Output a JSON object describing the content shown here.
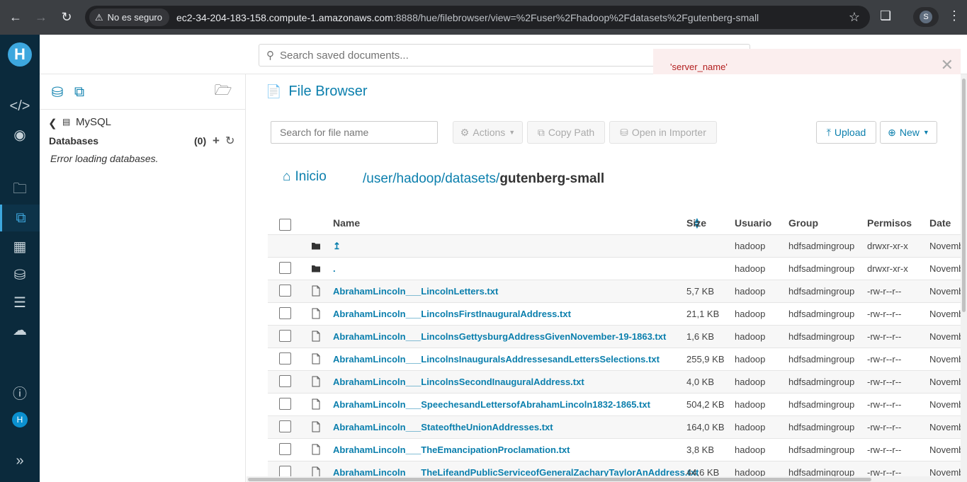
{
  "browser": {
    "security_label": "No es seguro",
    "url_host": "ec2-34-204-183-158.compute-1.amazonaws.com",
    "url_path": ":8888/hue/filebrowser/view=%2Fuser%2Fhadoop%2Fdatasets%2Fgutenberg-small",
    "profile_initial": "S"
  },
  "header": {
    "search_placeholder": "Search saved documents..."
  },
  "alert": {
    "message": "'server_name'"
  },
  "nav": {
    "logo_letter": "H",
    "avatar_letter": "H"
  },
  "assist": {
    "source": "MySQL",
    "databases_title": "Databases",
    "databases_count": "(0)",
    "error": "Error loading databases."
  },
  "main": {
    "title": "File Browser",
    "file_search_placeholder": "Search for file name",
    "actions_label": "Actions",
    "copy_path_label": "Copy Path",
    "open_importer_label": "Open in Importer",
    "upload_label": "Upload",
    "new_label": "New",
    "home_label": "Inicio",
    "path_prefix": "/user/hadoop/datasets/",
    "path_current": "gutenberg-small"
  },
  "table": {
    "headers": {
      "name": "Name",
      "size": "Size",
      "user": "Usuario",
      "group": "Group",
      "perms": "Permisos",
      "date": "Date"
    },
    "rows": [
      {
        "type": "folder",
        "name": "↥",
        "size": "",
        "user": "hadoop",
        "group": "hdfsadmingroup",
        "perms": "drwxr-xr-x",
        "date": "Novemb"
      },
      {
        "type": "folder",
        "name": ".",
        "size": "",
        "user": "hadoop",
        "group": "hdfsadmingroup",
        "perms": "drwxr-xr-x",
        "date": "Novemb"
      },
      {
        "type": "file",
        "name": "AbrahamLincoln___LincolnLetters.txt",
        "size": "5,7 KB",
        "user": "hadoop",
        "group": "hdfsadmingroup",
        "perms": "-rw-r--r--",
        "date": "Novemb"
      },
      {
        "type": "file",
        "name": "AbrahamLincoln___LincolnsFirstInauguralAddress.txt",
        "size": "21,1 KB",
        "user": "hadoop",
        "group": "hdfsadmingroup",
        "perms": "-rw-r--r--",
        "date": "Novemb"
      },
      {
        "type": "file",
        "name": "AbrahamLincoln___LincolnsGettysburgAddressGivenNovember-19-1863.txt",
        "size": "1,6 KB",
        "user": "hadoop",
        "group": "hdfsadmingroup",
        "perms": "-rw-r--r--",
        "date": "Novemb"
      },
      {
        "type": "file",
        "name": "AbrahamLincoln___LincolnsInauguralsAddressesandLettersSelections.txt",
        "size": "255,9 KB",
        "user": "hadoop",
        "group": "hdfsadmingroup",
        "perms": "-rw-r--r--",
        "date": "Novemb"
      },
      {
        "type": "file",
        "name": "AbrahamLincoln___LincolnsSecondInauguralAddress.txt",
        "size": "4,0 KB",
        "user": "hadoop",
        "group": "hdfsadmingroup",
        "perms": "-rw-r--r--",
        "date": "Novemb"
      },
      {
        "type": "file",
        "name": "AbrahamLincoln___SpeechesandLettersofAbrahamLincoln1832-1865.txt",
        "size": "504,2 KB",
        "user": "hadoop",
        "group": "hdfsadmingroup",
        "perms": "-rw-r--r--",
        "date": "Novemb"
      },
      {
        "type": "file",
        "name": "AbrahamLincoln___StateoftheUnionAddresses.txt",
        "size": "164,0 KB",
        "user": "hadoop",
        "group": "hdfsadmingroup",
        "perms": "-rw-r--r--",
        "date": "Novemb"
      },
      {
        "type": "file",
        "name": "AbrahamLincoln___TheEmancipationProclamation.txt",
        "size": "3,8 KB",
        "user": "hadoop",
        "group": "hdfsadmingroup",
        "perms": "-rw-r--r--",
        "date": "Novemb"
      },
      {
        "type": "file",
        "name": "AbrahamLincoln___TheLifeandPublicServiceofGeneralZacharyTaylorAnAddress.txt",
        "size": "44,6 KB",
        "user": "hadoop",
        "group": "hdfsadmingroup",
        "perms": "-rw-r--r--",
        "date": "Novemb"
      }
    ]
  },
  "colors": {
    "accent": "#0b7fad",
    "nav_bg": "#0b2a3c",
    "alert_text": "#b21e1e"
  }
}
